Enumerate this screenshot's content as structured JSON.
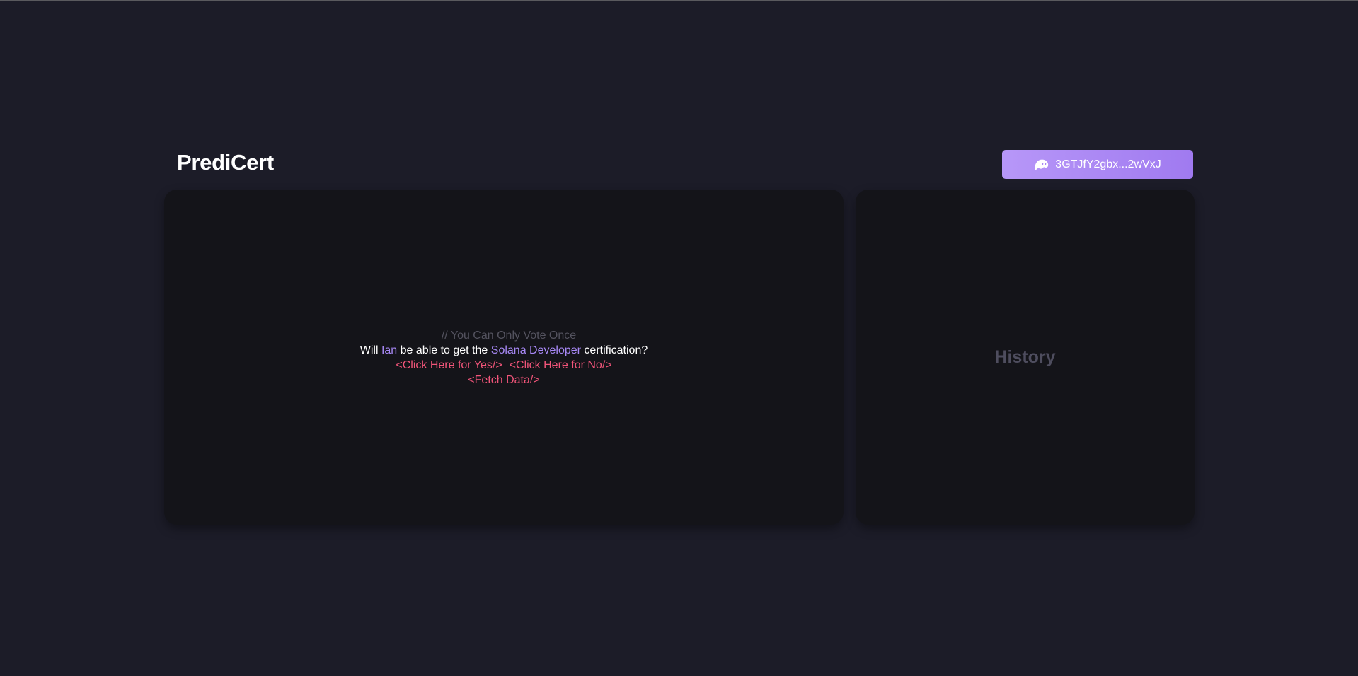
{
  "app": {
    "brand": "PrediCert"
  },
  "wallet": {
    "address": "3GTJfY2gbx...2wVxJ",
    "icon": "phantom-ghost-icon"
  },
  "vote": {
    "notice": "// You Can Only Vote Once",
    "question": {
      "prefix": "Will",
      "person": "Ian",
      "middle": "be able to get the",
      "certification": "Solana Developer",
      "suffix": "certification?"
    },
    "yes_label": "<Click Here for Yes/>",
    "no_label": "<Click Here for No/>",
    "fetch_label": "<Fetch Data/>"
  },
  "history": {
    "title": "History"
  },
  "colors": {
    "background": "#1c1c28",
    "panel": "#141419",
    "accent_purple": "#a788f5",
    "action_pink": "#f2557a",
    "button_gradient_start": "#b797f8",
    "button_gradient_end": "#a07af0"
  }
}
